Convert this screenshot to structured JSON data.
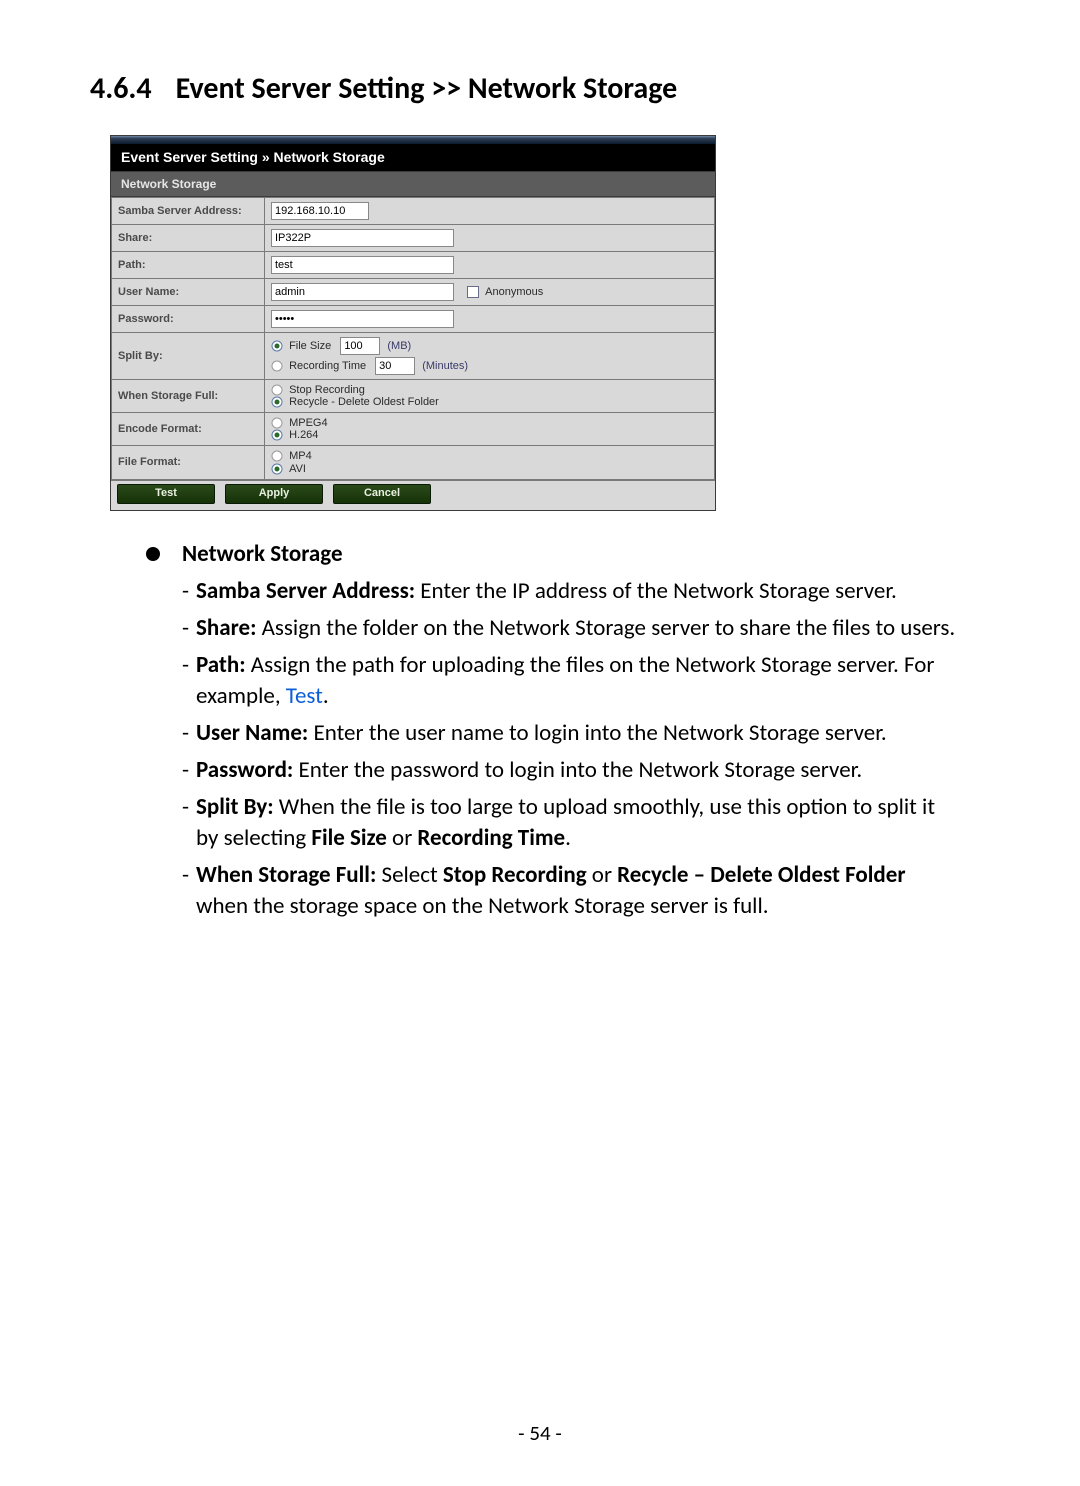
{
  "heading": {
    "number": "4.6.4",
    "title": "Event Server Setting >> Network Storage"
  },
  "window": {
    "title": "Event Server Setting » Network Storage",
    "section": "Network Storage",
    "rows": {
      "samba_label": "Samba Server Address:",
      "samba_value": "192.168.10.10",
      "share_label": "Share:",
      "share_value": "IP322P",
      "path_label": "Path:",
      "path_value": "test",
      "user_label": "User Name:",
      "user_value": "admin",
      "anon_label": "Anonymous",
      "pass_label": "Password:",
      "pass_value": "•••••",
      "split_label": "Split By:",
      "split_file_label": "File Size",
      "split_file_value": "100",
      "split_file_unit": "(MB)",
      "split_time_label": "Recording Time",
      "split_time_value": "30",
      "split_time_unit": "(Minutes)",
      "split_selected": "file_size",
      "full_label": "When Storage Full:",
      "full_opt_stop": "Stop Recording",
      "full_opt_recycle": "Recycle - Delete Oldest Folder",
      "full_selected": "recycle",
      "encode_label": "Encode Format:",
      "encode_opt_mpeg4": "MPEG4",
      "encode_opt_h264": "H.264",
      "encode_selected": "h264",
      "filefmt_label": "File Format:",
      "filefmt_opt_mp4": "MP4",
      "filefmt_opt_avi": "AVI",
      "filefmt_selected": "avi"
    },
    "buttons": {
      "test": "Test",
      "apply": "Apply",
      "cancel": "Cancel"
    }
  },
  "doc": {
    "bullet_label": "Network Storage",
    "items": [
      {
        "label": "Samba Server Address:",
        "text": " Enter the IP address of the Network Storage server."
      },
      {
        "label": "Share:",
        "text": " Assign the folder on the Network Storage server to share the files to users."
      },
      {
        "label": "Path:",
        "text_pre": " Assign the path for uploading the files on the Network Storage server. For example, ",
        "link": "Test",
        "text_post": "."
      },
      {
        "label": "User Name:",
        "text": " Enter the user name to login into the Network Storage server."
      },
      {
        "label": "Password:",
        "text": " Enter the password to login into the Network Storage server."
      },
      {
        "label": "Split By:",
        "text_pre": " When the file is too large to upload smoothly, use this option to split it by selecting ",
        "bold1": "File Size",
        "mid": " or ",
        "bold2": "Recording Time",
        "text_post": "."
      },
      {
        "label": "When Storage Full:",
        "text_pre": " Select ",
        "bold1": "Stop Recording",
        "mid": " or ",
        "bold2": "Recycle – Delete Oldest Folder",
        "text_post": " when the storage space on the Network Storage server is full."
      }
    ]
  },
  "page_number": "- 54 -"
}
